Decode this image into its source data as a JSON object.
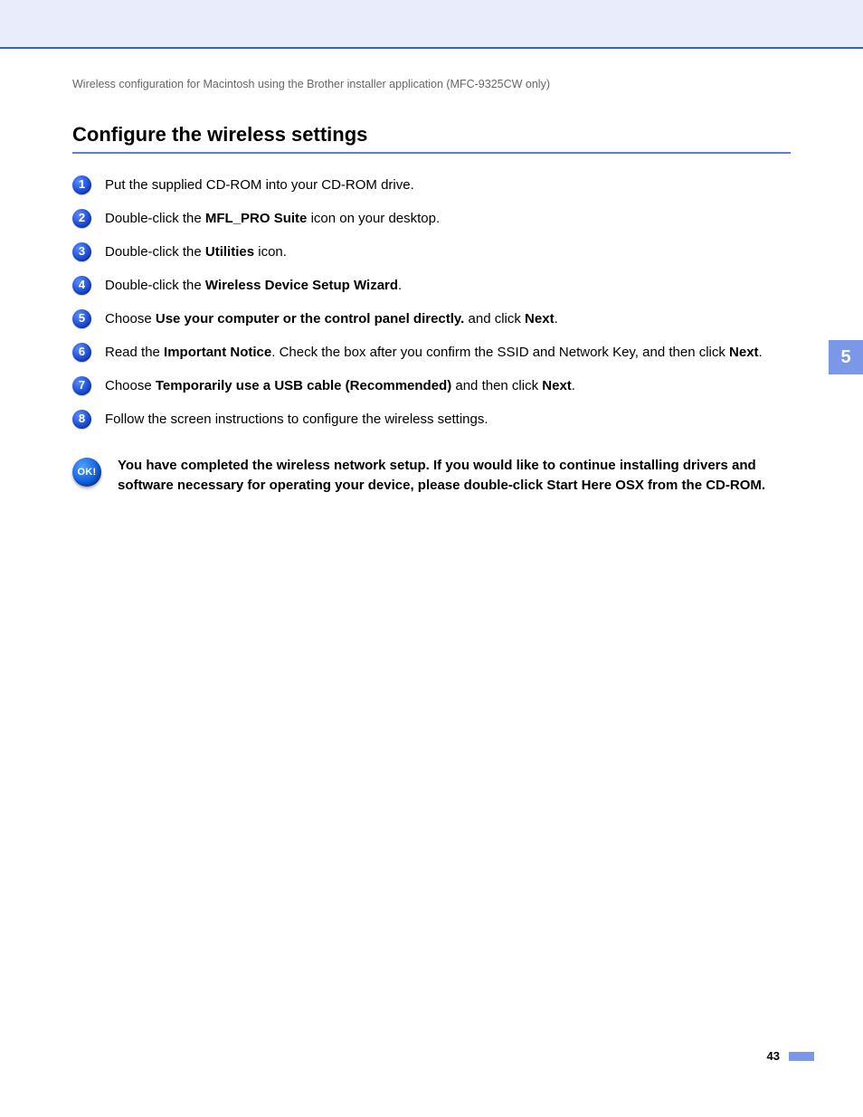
{
  "breadcrumb": "Wireless configuration for Macintosh using the Brother installer application (MFC-9325CW only)",
  "sectionTitle": "Configure the wireless settings",
  "steps": [
    {
      "n": "1",
      "parts": [
        "Put the supplied CD-ROM into your CD-ROM drive."
      ]
    },
    {
      "n": "2",
      "parts": [
        "Double-click the ",
        {
          "b": "MFL_PRO Suite"
        },
        " icon on your desktop."
      ]
    },
    {
      "n": "3",
      "parts": [
        "Double-click the ",
        {
          "b": "Utilities"
        },
        " icon."
      ]
    },
    {
      "n": "4",
      "parts": [
        "Double-click the ",
        {
          "b": "Wireless Device Setup Wizard"
        },
        "."
      ]
    },
    {
      "n": "5",
      "parts": [
        "Choose ",
        {
          "b": "Use your computer or the control panel directly."
        },
        " and click ",
        {
          "b": "Next"
        },
        "."
      ]
    },
    {
      "n": "6",
      "parts": [
        "Read the ",
        {
          "b": "Important Notice"
        },
        ". Check the box after you confirm the SSID and Network Key, and then click ",
        {
          "b": "Next"
        },
        "."
      ]
    },
    {
      "n": "7",
      "parts": [
        "Choose ",
        {
          "b": "Temporarily use a USB cable (Recommended)"
        },
        " and then click ",
        {
          "b": "Next"
        },
        "."
      ]
    },
    {
      "n": "8",
      "parts": [
        "Follow the screen instructions to configure the wireless settings."
      ]
    }
  ],
  "okBadge": "OK!",
  "okText": "You have completed the wireless network setup. If you would like to continue installing drivers and software necessary for operating your device, please double-click Start Here OSX from the CD-ROM.",
  "sideTab": "5",
  "pageNumber": "43"
}
